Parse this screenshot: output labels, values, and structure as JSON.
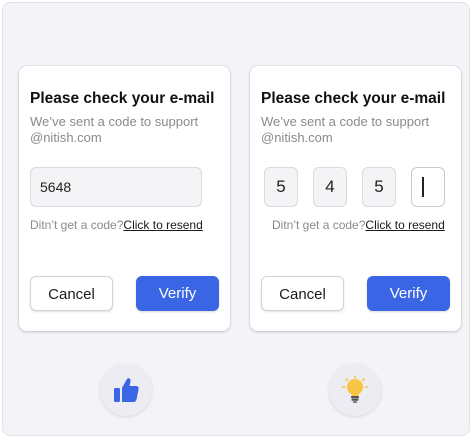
{
  "colors": {
    "accent": "#3a66e6",
    "frame_bg": "#f3f3f8",
    "bulb": "#f6c642"
  },
  "cards": [
    {
      "title": "Please check your e-mail",
      "subtitle": "We’ve sent a code to support @nitish.com",
      "code_value": "5648",
      "resend_prefix": "Ditn’t get a code?",
      "resend_link": "Click to resend",
      "cancel_label": "Cancel",
      "verify_label": "Verify"
    },
    {
      "title": "Please check your e-mail",
      "subtitle": "We’ve sent a code to support @nitish.com",
      "digits": [
        "5",
        "4",
        "5",
        ""
      ],
      "resend_prefix": "Ditn’t get a code?",
      "resend_link": "Click to resend",
      "cancel_label": "Cancel",
      "verify_label": "Verify"
    }
  ],
  "badges": [
    {
      "icon": "thumbs-up-icon"
    },
    {
      "icon": "lightbulb-icon"
    }
  ]
}
